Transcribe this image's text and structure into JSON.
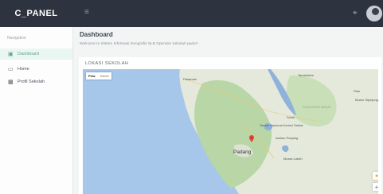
{
  "header": {
    "brand": "C_PANEL",
    "menu_icon": "hamburger-icon",
    "fullscreen_icon": "fullscreen-icon",
    "avatar_icon": "user-avatar"
  },
  "sidebar": {
    "title": "Navigation",
    "items": [
      {
        "label": "Dashboard",
        "icon": "dashboard-icon",
        "active": true
      },
      {
        "label": "Home",
        "icon": "monitor-icon",
        "active": false
      },
      {
        "label": "Profil Sekolah",
        "icon": "building-icon",
        "active": false
      }
    ]
  },
  "main": {
    "title": "Dashboard",
    "subtitle": "Welcome to Sistem Informasi Geografis SLB Operator Sekolah padel !",
    "panel_title": "LOKASI SEKOLAH"
  },
  "map": {
    "toggle": {
      "selected": "Peta",
      "other": "Satelit"
    },
    "places": {
      "padang": "Padang",
      "pariaman": "Pariaman",
      "tanahdatar": "Tanahdatar",
      "sumatera_barat": "SUMATERA BARAT",
      "solok": "Solok",
      "taman_nasional": "Taman Nasional Kerinci Seblat",
      "muara_labuh": "Muara Labuh",
      "riau": "Riau",
      "alahan": "Alahan Panjang",
      "bukittinggi": "Bukittinggi",
      "muaro": "Muaro Sijunjung"
    },
    "marker_color": "#e7463a",
    "pegman_icon": "pegman-icon",
    "zoom_in_label": "+"
  },
  "colors": {
    "topbar": "#2d3440",
    "active_item": "#5fa385",
    "sea": "#a6c7ea",
    "land": "#e5e9dc",
    "forest": "#b8d6a6"
  }
}
